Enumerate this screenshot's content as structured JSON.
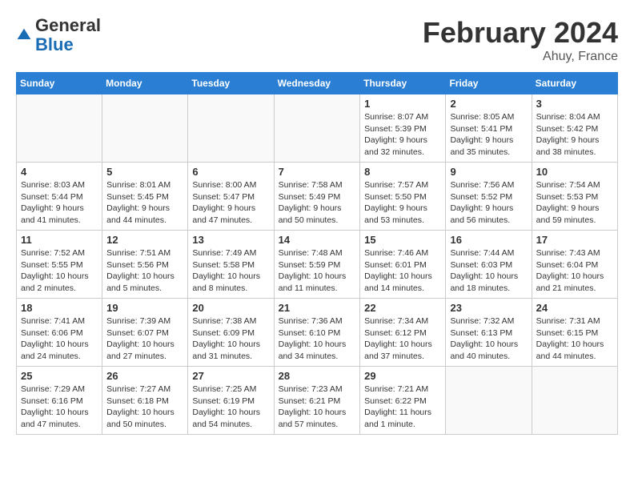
{
  "header": {
    "logo_general": "General",
    "logo_blue": "Blue",
    "month_title": "February 2024",
    "location": "Ahuy, France"
  },
  "calendar": {
    "days_of_week": [
      "Sunday",
      "Monday",
      "Tuesday",
      "Wednesday",
      "Thursday",
      "Friday",
      "Saturday"
    ],
    "weeks": [
      [
        {
          "day": "",
          "info": ""
        },
        {
          "day": "",
          "info": ""
        },
        {
          "day": "",
          "info": ""
        },
        {
          "day": "",
          "info": ""
        },
        {
          "day": "1",
          "info": "Sunrise: 8:07 AM\nSunset: 5:39 PM\nDaylight: 9 hours\nand 32 minutes."
        },
        {
          "day": "2",
          "info": "Sunrise: 8:05 AM\nSunset: 5:41 PM\nDaylight: 9 hours\nand 35 minutes."
        },
        {
          "day": "3",
          "info": "Sunrise: 8:04 AM\nSunset: 5:42 PM\nDaylight: 9 hours\nand 38 minutes."
        }
      ],
      [
        {
          "day": "4",
          "info": "Sunrise: 8:03 AM\nSunset: 5:44 PM\nDaylight: 9 hours\nand 41 minutes."
        },
        {
          "day": "5",
          "info": "Sunrise: 8:01 AM\nSunset: 5:45 PM\nDaylight: 9 hours\nand 44 minutes."
        },
        {
          "day": "6",
          "info": "Sunrise: 8:00 AM\nSunset: 5:47 PM\nDaylight: 9 hours\nand 47 minutes."
        },
        {
          "day": "7",
          "info": "Sunrise: 7:58 AM\nSunset: 5:49 PM\nDaylight: 9 hours\nand 50 minutes."
        },
        {
          "day": "8",
          "info": "Sunrise: 7:57 AM\nSunset: 5:50 PM\nDaylight: 9 hours\nand 53 minutes."
        },
        {
          "day": "9",
          "info": "Sunrise: 7:56 AM\nSunset: 5:52 PM\nDaylight: 9 hours\nand 56 minutes."
        },
        {
          "day": "10",
          "info": "Sunrise: 7:54 AM\nSunset: 5:53 PM\nDaylight: 9 hours\nand 59 minutes."
        }
      ],
      [
        {
          "day": "11",
          "info": "Sunrise: 7:52 AM\nSunset: 5:55 PM\nDaylight: 10 hours\nand 2 minutes."
        },
        {
          "day": "12",
          "info": "Sunrise: 7:51 AM\nSunset: 5:56 PM\nDaylight: 10 hours\nand 5 minutes."
        },
        {
          "day": "13",
          "info": "Sunrise: 7:49 AM\nSunset: 5:58 PM\nDaylight: 10 hours\nand 8 minutes."
        },
        {
          "day": "14",
          "info": "Sunrise: 7:48 AM\nSunset: 5:59 PM\nDaylight: 10 hours\nand 11 minutes."
        },
        {
          "day": "15",
          "info": "Sunrise: 7:46 AM\nSunset: 6:01 PM\nDaylight: 10 hours\nand 14 minutes."
        },
        {
          "day": "16",
          "info": "Sunrise: 7:44 AM\nSunset: 6:03 PM\nDaylight: 10 hours\nand 18 minutes."
        },
        {
          "day": "17",
          "info": "Sunrise: 7:43 AM\nSunset: 6:04 PM\nDaylight: 10 hours\nand 21 minutes."
        }
      ],
      [
        {
          "day": "18",
          "info": "Sunrise: 7:41 AM\nSunset: 6:06 PM\nDaylight: 10 hours\nand 24 minutes."
        },
        {
          "day": "19",
          "info": "Sunrise: 7:39 AM\nSunset: 6:07 PM\nDaylight: 10 hours\nand 27 minutes."
        },
        {
          "day": "20",
          "info": "Sunrise: 7:38 AM\nSunset: 6:09 PM\nDaylight: 10 hours\nand 31 minutes."
        },
        {
          "day": "21",
          "info": "Sunrise: 7:36 AM\nSunset: 6:10 PM\nDaylight: 10 hours\nand 34 minutes."
        },
        {
          "day": "22",
          "info": "Sunrise: 7:34 AM\nSunset: 6:12 PM\nDaylight: 10 hours\nand 37 minutes."
        },
        {
          "day": "23",
          "info": "Sunrise: 7:32 AM\nSunset: 6:13 PM\nDaylight: 10 hours\nand 40 minutes."
        },
        {
          "day": "24",
          "info": "Sunrise: 7:31 AM\nSunset: 6:15 PM\nDaylight: 10 hours\nand 44 minutes."
        }
      ],
      [
        {
          "day": "25",
          "info": "Sunrise: 7:29 AM\nSunset: 6:16 PM\nDaylight: 10 hours\nand 47 minutes."
        },
        {
          "day": "26",
          "info": "Sunrise: 7:27 AM\nSunset: 6:18 PM\nDaylight: 10 hours\nand 50 minutes."
        },
        {
          "day": "27",
          "info": "Sunrise: 7:25 AM\nSunset: 6:19 PM\nDaylight: 10 hours\nand 54 minutes."
        },
        {
          "day": "28",
          "info": "Sunrise: 7:23 AM\nSunset: 6:21 PM\nDaylight: 10 hours\nand 57 minutes."
        },
        {
          "day": "29",
          "info": "Sunrise: 7:21 AM\nSunset: 6:22 PM\nDaylight: 11 hours\nand 1 minute."
        },
        {
          "day": "",
          "info": ""
        },
        {
          "day": "",
          "info": ""
        }
      ]
    ]
  }
}
